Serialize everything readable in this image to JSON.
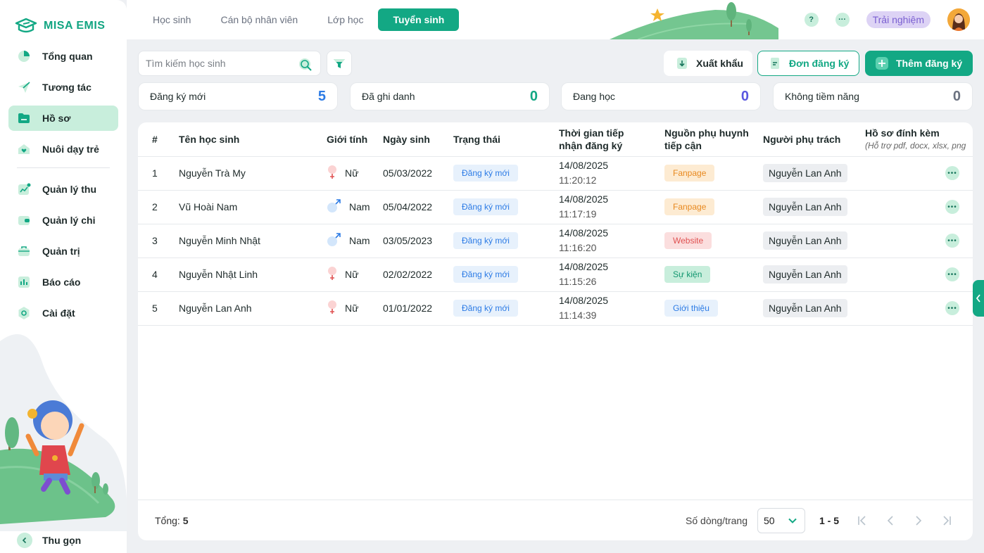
{
  "brand": {
    "name": "MISA EMIS",
    "color": "#13a884"
  },
  "sidebar": {
    "items": [
      {
        "label": "Tổng quan",
        "icon": "pie-chart-icon"
      },
      {
        "label": "Tương tác",
        "icon": "send-icon"
      },
      {
        "label": "Hồ sơ",
        "icon": "folder-icon",
        "active": true
      },
      {
        "label": "Nuôi dạy trẻ",
        "icon": "house-heart-icon"
      },
      {
        "label": "Quản lý thu",
        "icon": "income-chart-icon"
      },
      {
        "label": "Quản lý chi",
        "icon": "wallet-icon"
      },
      {
        "label": "Quản trị",
        "icon": "briefcase-icon"
      },
      {
        "label": "Báo cáo",
        "icon": "bar-chart-icon"
      },
      {
        "label": "Cài đặt",
        "icon": "gear-icon"
      }
    ],
    "collapse_label": "Thu gọn"
  },
  "topbar": {
    "tabs": [
      {
        "label": "Học sinh"
      },
      {
        "label": "Cán bộ nhân viên"
      },
      {
        "label": "Lớp học"
      },
      {
        "label": "Tuyển sinh",
        "active": true
      }
    ],
    "help_icon": "?",
    "more_icon": "···",
    "trial_label": "Trải nghiệm"
  },
  "toolbar": {
    "search_placeholder": "Tìm kiếm học sinh",
    "export_label": "Xuất khẩu",
    "form_label": "Đơn đăng ký",
    "add_label": "Thêm đăng ký"
  },
  "stats": [
    {
      "label": "Đăng ký mới",
      "value": "5",
      "color": "#2c7be5"
    },
    {
      "label": "Đã ghi danh",
      "value": "0",
      "color": "#13a884"
    },
    {
      "label": "Đang học",
      "value": "0",
      "color": "#5a57e0"
    },
    {
      "label": "Không tiềm năng",
      "value": "0",
      "color": "#6b7280"
    }
  ],
  "table": {
    "headers": {
      "index": "#",
      "name": "Tên học sinh",
      "gender": "Giới tính",
      "dob": "Ngày sinh",
      "status": "Trạng thái",
      "received_line1": "Thời gian tiếp",
      "received_line2": "nhận đăng ký",
      "source_line1": "Nguồn phụ huynh",
      "source_line2": "tiếp cận",
      "owner": "Người phụ trách",
      "attach": "Hồ sơ đính kèm",
      "attach_sub": "(Hỗ trợ pdf, docx, xlsx, png"
    },
    "rows": [
      {
        "index": "1",
        "name": "Nguyễn Trà My",
        "gender": "Nữ",
        "gender_icon": "female-icon",
        "dob": "05/03/2022",
        "status": "Đăng ký mới",
        "date": "14/08/2025",
        "time": "11:20:12",
        "source": "Fanpage",
        "source_kind": "fanpage",
        "owner": "Nguyễn Lan Anh"
      },
      {
        "index": "2",
        "name": "Vũ Hoài Nam",
        "gender": "Nam",
        "gender_icon": "male-icon",
        "dob": "05/04/2022",
        "status": "Đăng ký mới",
        "date": "14/08/2025",
        "time": "11:17:19",
        "source": "Fanpage",
        "source_kind": "fanpage",
        "owner": "Nguyễn Lan Anh"
      },
      {
        "index": "3",
        "name": "Nguyễn Minh Nhật",
        "gender": "Nam",
        "gender_icon": "male-icon",
        "dob": "03/05/2023",
        "status": "Đăng ký mới",
        "date": "14/08/2025",
        "time": "11:16:20",
        "source": "Website",
        "source_kind": "website",
        "owner": "Nguyễn Lan Anh"
      },
      {
        "index": "4",
        "name": "Nguyễn Nhật Linh",
        "gender": "Nữ",
        "gender_icon": "female-icon",
        "dob": "02/02/2022",
        "status": "Đăng ký mới",
        "date": "14/08/2025",
        "time": "11:15:26",
        "source": "Sự kiện",
        "source_kind": "event",
        "owner": "Nguyễn Lan Anh"
      },
      {
        "index": "5",
        "name": "Nguyễn Lan Anh",
        "gender": "Nữ",
        "gender_icon": "female-icon",
        "dob": "01/01/2022",
        "status": "Đăng ký mới",
        "date": "14/08/2025",
        "time": "11:14:39",
        "source": "Giới thiệu",
        "source_kind": "intro",
        "owner": "Nguyễn Lan Anh"
      }
    ]
  },
  "footer": {
    "total_label": "Tổng:",
    "total_value": "5",
    "rows_per_page_label": "Số dòng/trang",
    "rows_per_page_value": "50",
    "range": "1 - 5"
  }
}
